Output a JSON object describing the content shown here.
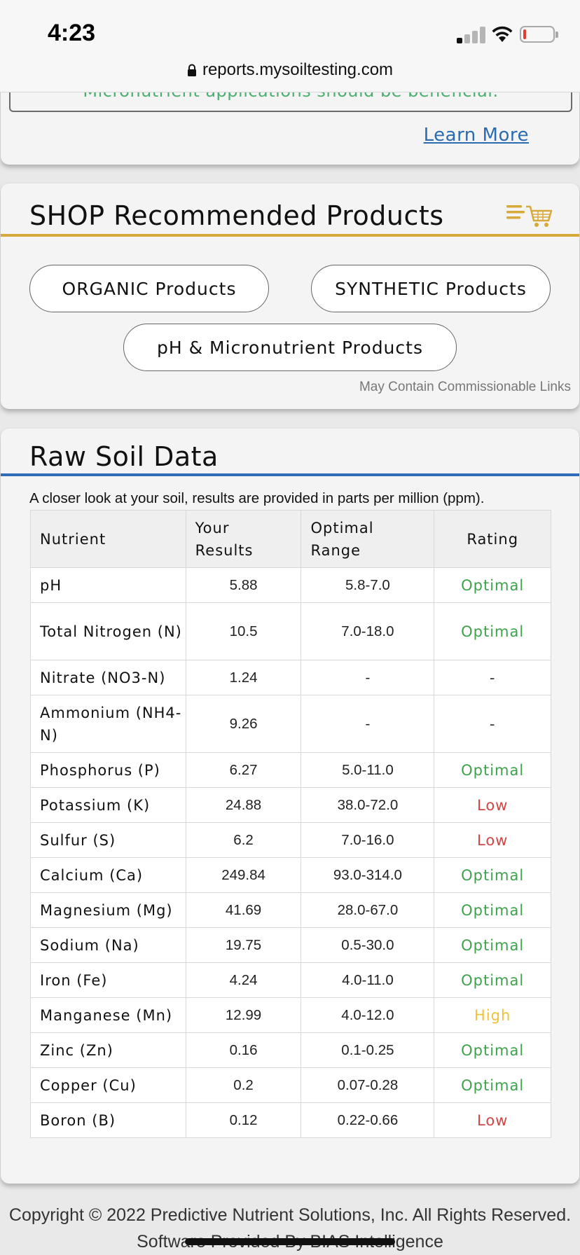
{
  "status_bar": {
    "time": "4:23",
    "url": "reports.mysoiltesting.com",
    "icons": [
      "signal-icon",
      "wifi-icon",
      "battery-icon",
      "lock-icon"
    ]
  },
  "top_section": {
    "notice": "Micronutrient applications should be beneficial.",
    "learn_more": "Learn More"
  },
  "shop": {
    "title": "SHOP Recommended Products",
    "cart_icon": "cart-icon",
    "organic_button": "ORGANIC Products",
    "synthetic_button": "SYNTHETIC Products",
    "ph_button": "pH & Micronutrient Products",
    "disclaimer": "May Contain Commissionable Links",
    "accent_color": "#d7a93a"
  },
  "raw": {
    "title": "Raw Soil Data",
    "intro": "A closer look at your soil, results are provided in parts per million (ppm).",
    "accent_color": "#2f6db8",
    "headers": {
      "nutrient": "Nutrient",
      "your_results": "Your Results",
      "optimal_range": "Optimal Range",
      "rating": "Rating"
    },
    "rows": [
      {
        "nutrient": "pH",
        "result": "5.88",
        "range": "5.8-7.0",
        "rating": "Optimal"
      },
      {
        "nutrient": "Total Nitrogen (N)",
        "result": "10.5",
        "range": "7.0-18.0",
        "rating": "Optimal"
      },
      {
        "nutrient": "Nitrate (NO3-N)",
        "result": "1.24",
        "range": "-",
        "rating": "-"
      },
      {
        "nutrient": "Ammonium (NH4-N)",
        "result": "9.26",
        "range": "-",
        "rating": "-"
      },
      {
        "nutrient": "Phosphorus (P)",
        "result": "6.27",
        "range": "5.0-11.0",
        "rating": "Optimal"
      },
      {
        "nutrient": "Potassium (K)",
        "result": "24.88",
        "range": "38.0-72.0",
        "rating": "Low"
      },
      {
        "nutrient": "Sulfur (S)",
        "result": "6.2",
        "range": "7.0-16.0",
        "rating": "Low"
      },
      {
        "nutrient": "Calcium (Ca)",
        "result": "249.84",
        "range": "93.0-314.0",
        "rating": "Optimal"
      },
      {
        "nutrient": "Magnesium (Mg)",
        "result": "41.69",
        "range": "28.0-67.0",
        "rating": "Optimal"
      },
      {
        "nutrient": "Sodium (Na)",
        "result": "19.75",
        "range": "0.5-30.0",
        "rating": "Optimal"
      },
      {
        "nutrient": "Iron (Fe)",
        "result": "4.24",
        "range": "4.0-11.0",
        "rating": "Optimal"
      },
      {
        "nutrient": "Manganese (Mn)",
        "result": "12.99",
        "range": "4.0-12.0",
        "rating": "High"
      },
      {
        "nutrient": "Zinc (Zn)",
        "result": "0.16",
        "range": "0.1-0.25",
        "rating": "Optimal"
      },
      {
        "nutrient": "Copper (Cu)",
        "result": "0.2",
        "range": "0.07-0.28",
        "rating": "Optimal"
      },
      {
        "nutrient": "Boron (B)",
        "result": "0.12",
        "range": "0.22-0.66",
        "rating": "Low"
      }
    ],
    "rating_colors": {
      "Optimal": "#3ea24d",
      "Low": "#d24646",
      "High": "#f0c23a"
    }
  },
  "footer": {
    "copyright": "Copyright © 2022 Predictive Nutrient Solutions, Inc. All Rights Reserved.",
    "software": "Software Provided By BIAS Intelligence"
  }
}
